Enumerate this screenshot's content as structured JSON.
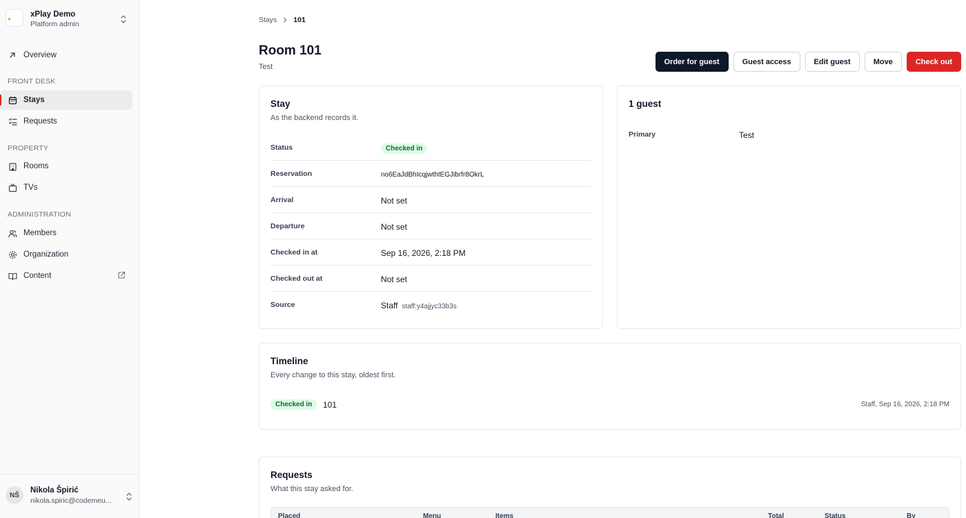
{
  "org": {
    "name": "xPlay Demo",
    "role": "Platform admin"
  },
  "nav": {
    "overview": "Overview",
    "sections": {
      "front_desk": "FRONT DESK",
      "property": "PROPERTY",
      "administration": "ADMINISTRATION"
    },
    "stays": "Stays",
    "requests": "Requests",
    "rooms": "Rooms",
    "tvs": "TVs",
    "members": "Members",
    "organization": "Organization",
    "content": "Content"
  },
  "user": {
    "initials": "NŠ",
    "name": "Nikola Špirić",
    "email": "nikola.spiric@codemeu..."
  },
  "breadcrumb": {
    "parent": "Stays",
    "current": "101"
  },
  "page": {
    "title": "Room 101",
    "subtitle": "Test"
  },
  "actions": {
    "order": "Order for guest",
    "guest_access": "Guest access",
    "edit_guest": "Edit guest",
    "move": "Move",
    "check_out": "Check out"
  },
  "stay": {
    "title": "Stay",
    "subtitle": "As the backend records it.",
    "rows": [
      {
        "label": "Status",
        "value": "Checked in"
      },
      {
        "label": "Reservation",
        "value": "no6EaJdBhIcqjwthtEGJibrfr8OkrL"
      },
      {
        "label": "Arrival",
        "value": "Not set"
      },
      {
        "label": "Departure",
        "value": "Not set"
      },
      {
        "label": "Checked in at",
        "value": "Sep 16, 2026, 2:18 PM"
      },
      {
        "label": "Checked out at",
        "value": "Not set"
      },
      {
        "label": "Source",
        "value": "Staff",
        "detail": "staff:y4ajjyc33b3s"
      }
    ]
  },
  "guests": {
    "title": "1 guest",
    "primary_label": "Primary",
    "primary_value": "Test"
  },
  "timeline": {
    "title": "Timeline",
    "subtitle": "Every change to this stay, oldest first.",
    "entries": [
      {
        "badge": "Checked in",
        "room": "101",
        "meta": "Staff, Sep 16, 2026, 2:18 PM"
      }
    ]
  },
  "requests": {
    "title": "Requests",
    "subtitle": "What this stay asked for.",
    "columns": [
      "Placed",
      "Menu",
      "Items",
      "Total",
      "Status",
      "By"
    ]
  },
  "colors": {
    "accent_dark": "#0f172a",
    "danger": "#dc2626",
    "success_bg": "#dcfce7",
    "success_text": "#166534"
  }
}
